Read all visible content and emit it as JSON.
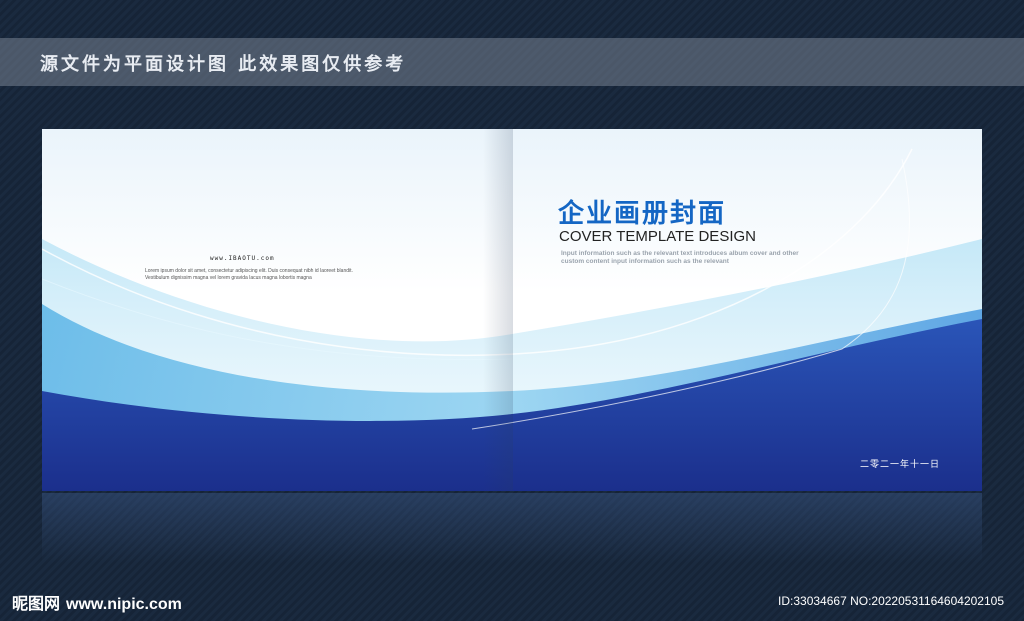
{
  "banner": {
    "text": "源文件为平面设计图 此效果图仅供参考"
  },
  "back_cover": {
    "url": "www.IBAOTU.com",
    "body": "Lorem ipsum dolor sit amet, consectetur adipiscing elit. Duis consequat nibh id laoreet blandit. Vestibulum dignissim magna vel lorem gravida lacus magna lobortis magna"
  },
  "front_cover": {
    "title_cn": "企业画册封面",
    "title_en": "COVER TEMPLATE DESIGN",
    "subtitle": "Input information such as the relevant text introduces album cover and other custom content input information such as the relevant",
    "date": "二零二一年十一日"
  },
  "watermark": {
    "logo": "昵图网",
    "site": "www.nipic.com",
    "id": "ID:33034667 NO:20220531164604202105"
  },
  "colors": {
    "accent": "#1466c4",
    "deep_blue": "#1e3a9e",
    "light_blue": "#4aa8e0"
  }
}
